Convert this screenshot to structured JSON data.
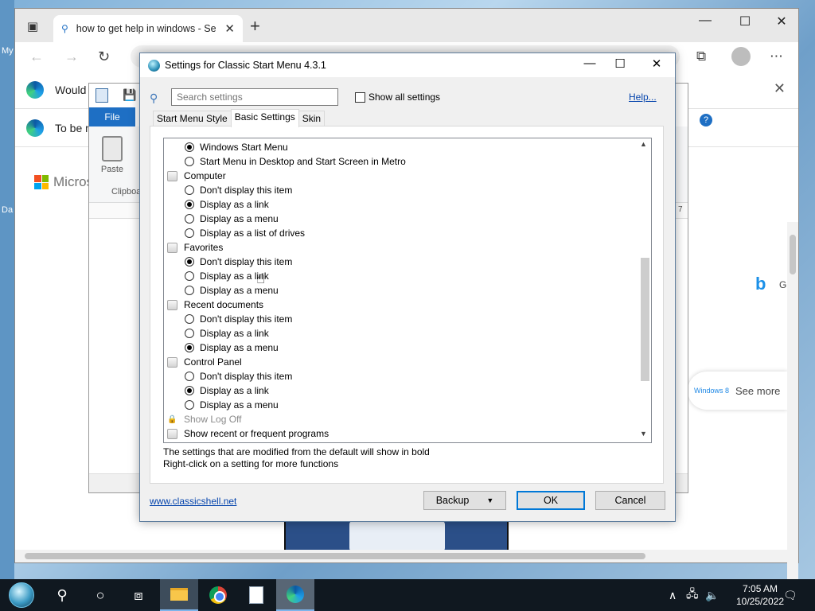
{
  "desktop": {
    "icon_labels": [
      "My",
      "Da"
    ]
  },
  "browser": {
    "tab_title": "how to get help in windows - Se",
    "window_controls": {
      "minimize": "—",
      "maximize": "☐",
      "close": "✕"
    },
    "infobar1_text": "Would",
    "infobar2_text": "To be m",
    "microsoft_label": "Microso",
    "bing_letter": "G",
    "see_more_tag": "Windows 8",
    "see_more": "See more"
  },
  "wordpad": {
    "file_tab": "File",
    "paste_label": "Paste",
    "clipboard_label": "Clipboa",
    "ruler_num": "7"
  },
  "dialog": {
    "title": "Settings for Classic Start Menu 4.3.1",
    "search_placeholder": "Search settings",
    "show_all_label": "Show all settings",
    "help_label": "Help...",
    "tabs": [
      {
        "label": "Start Menu Style",
        "active": false
      },
      {
        "label": "Basic Settings",
        "active": true
      },
      {
        "label": "Skin",
        "active": false
      }
    ],
    "tree": [
      {
        "type": "radio",
        "label": "Windows Start Menu",
        "checked": true
      },
      {
        "type": "radio",
        "label": "Start Menu in Desktop and Start Screen in Metro",
        "checked": false
      },
      {
        "type": "category",
        "label": "Computer"
      },
      {
        "type": "radio",
        "label": "Don't display this item",
        "checked": false
      },
      {
        "type": "radio",
        "label": "Display as a link",
        "checked": true
      },
      {
        "type": "radio",
        "label": "Display as a menu",
        "checked": false
      },
      {
        "type": "radio",
        "label": "Display as a list of drives",
        "checked": false
      },
      {
        "type": "category",
        "label": "Favorites"
      },
      {
        "type": "radio",
        "label": "Don't display this item",
        "checked": true
      },
      {
        "type": "radio",
        "label": "Display as a link",
        "checked": false
      },
      {
        "type": "radio",
        "label": "Display as a menu",
        "checked": false
      },
      {
        "type": "category",
        "label": "Recent documents"
      },
      {
        "type": "radio",
        "label": "Don't display this item",
        "checked": false
      },
      {
        "type": "radio",
        "label": "Display as a link",
        "checked": false
      },
      {
        "type": "radio",
        "label": "Display as a menu",
        "checked": true
      },
      {
        "type": "category",
        "label": "Control Panel"
      },
      {
        "type": "radio",
        "label": "Don't display this item",
        "checked": false
      },
      {
        "type": "radio",
        "label": "Display as a link",
        "checked": true
      },
      {
        "type": "radio",
        "label": "Display as a menu",
        "checked": false
      },
      {
        "type": "locked",
        "label": "Show Log Off"
      },
      {
        "type": "category",
        "label": "Show recent or frequent programs"
      }
    ],
    "hint_line1": "The settings that are modified from the default will show in bold",
    "hint_line2": "Right-click on a setting for more functions",
    "site_link": "www.classicshell.net",
    "backup_button": "Backup",
    "ok_button": "OK",
    "cancel_button": "Cancel"
  },
  "taskbar": {
    "time": "7:05 AM",
    "date": "10/25/2022"
  }
}
